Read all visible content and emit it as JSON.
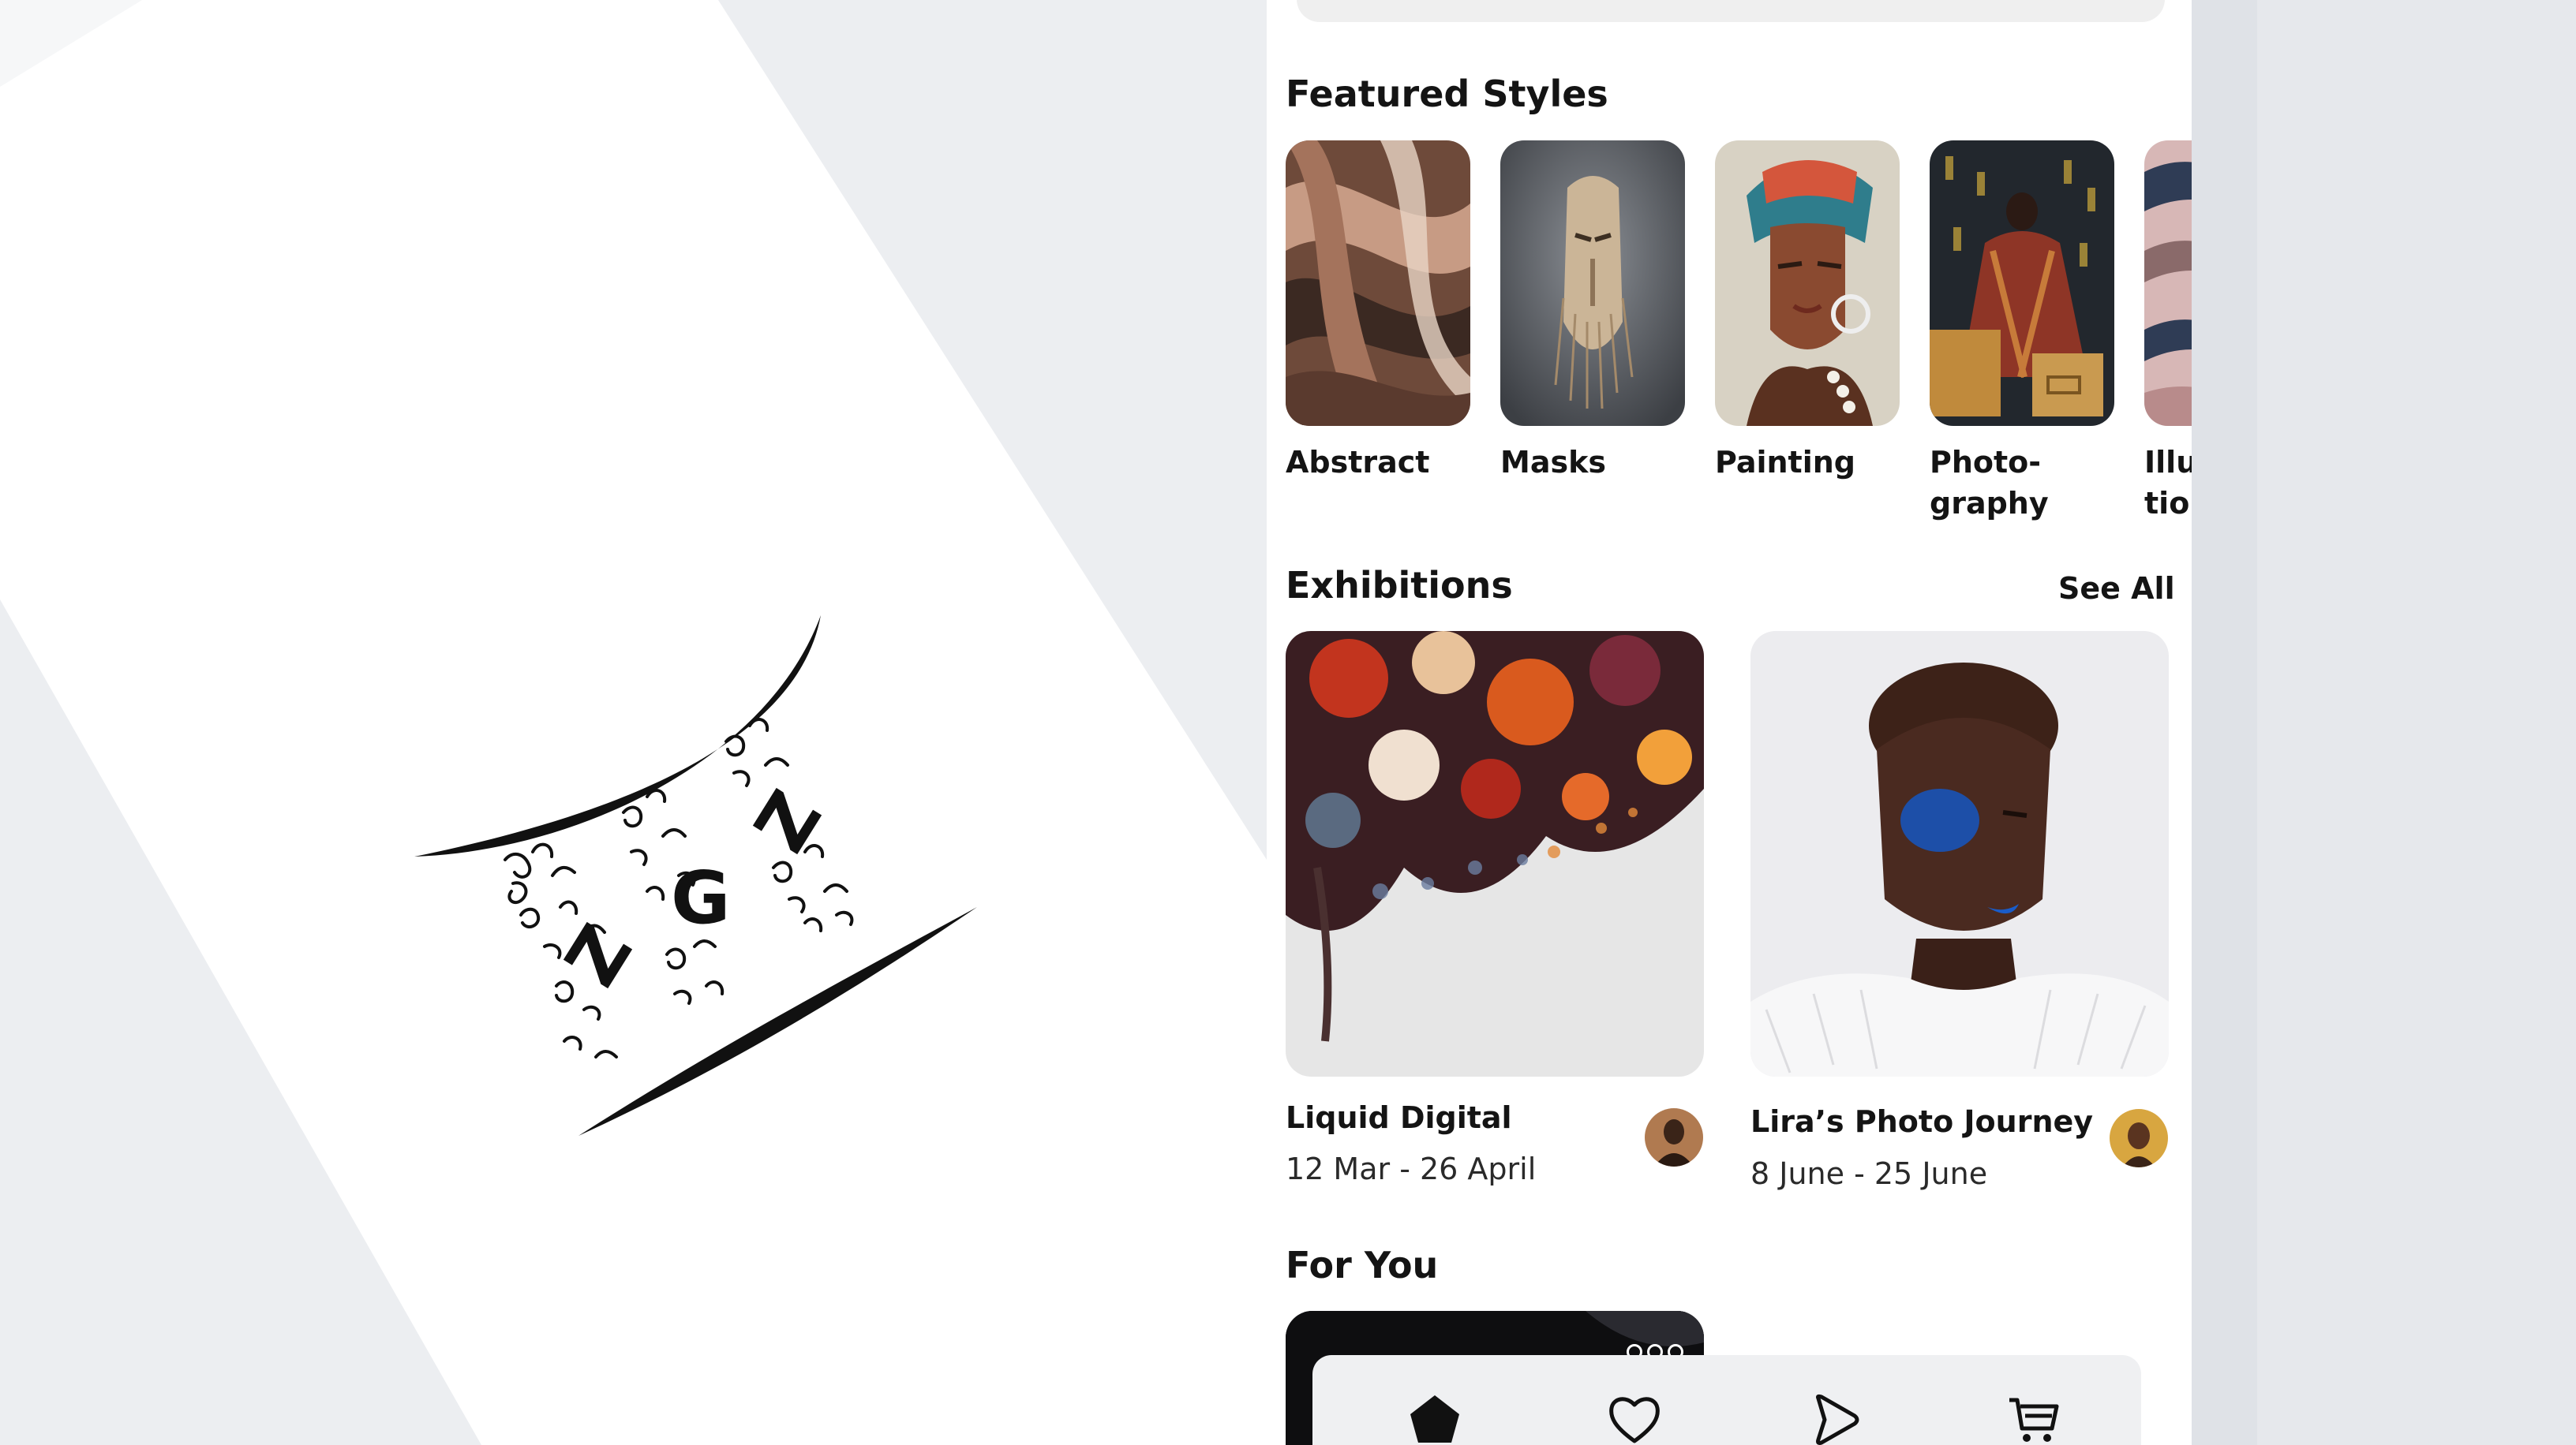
{
  "brand": {
    "logo_letters": [
      "Z",
      "G",
      "Z"
    ],
    "logo_description_icon": "calligraphic-hourglass-logo"
  },
  "featured": {
    "title": "Featured Styles",
    "items": [
      {
        "label": "Abstract",
        "image": "abstract-swirl-image"
      },
      {
        "label": "Masks",
        "image": "wooden-mask-image"
      },
      {
        "label": "Painting",
        "image": "portrait-painting-image"
      },
      {
        "label": "Photo-\ngraphy",
        "image": "fashion-photo-image"
      },
      {
        "label": "Illus-\ntion",
        "image": "illustration-image"
      }
    ]
  },
  "exhibitions": {
    "title": "Exhibitions",
    "see_all": "See All",
    "items": [
      {
        "title": "Liquid Digital",
        "dates": "12 Mar - 26 April",
        "image": "fluid-art-image",
        "avatar": "artist-avatar"
      },
      {
        "title": "Lira’s Photo Journey",
        "dates": "8 June - 25 June",
        "image": "blue-makeup-portrait-image",
        "avatar": "photographer-avatar"
      }
    ]
  },
  "for_you": {
    "title": "For You"
  },
  "tabbar": {
    "tabs": [
      {
        "name": "home",
        "icon": "home-icon",
        "active": true
      },
      {
        "name": "favorites",
        "icon": "heart-icon",
        "active": false
      },
      {
        "name": "play",
        "icon": "play-icon",
        "active": false
      },
      {
        "name": "cart",
        "icon": "cart-icon",
        "active": false
      }
    ]
  },
  "colors": {
    "background": "#eceef1",
    "card": "#ffffff",
    "text": "#141414",
    "tabbar": "#eff0f2"
  }
}
